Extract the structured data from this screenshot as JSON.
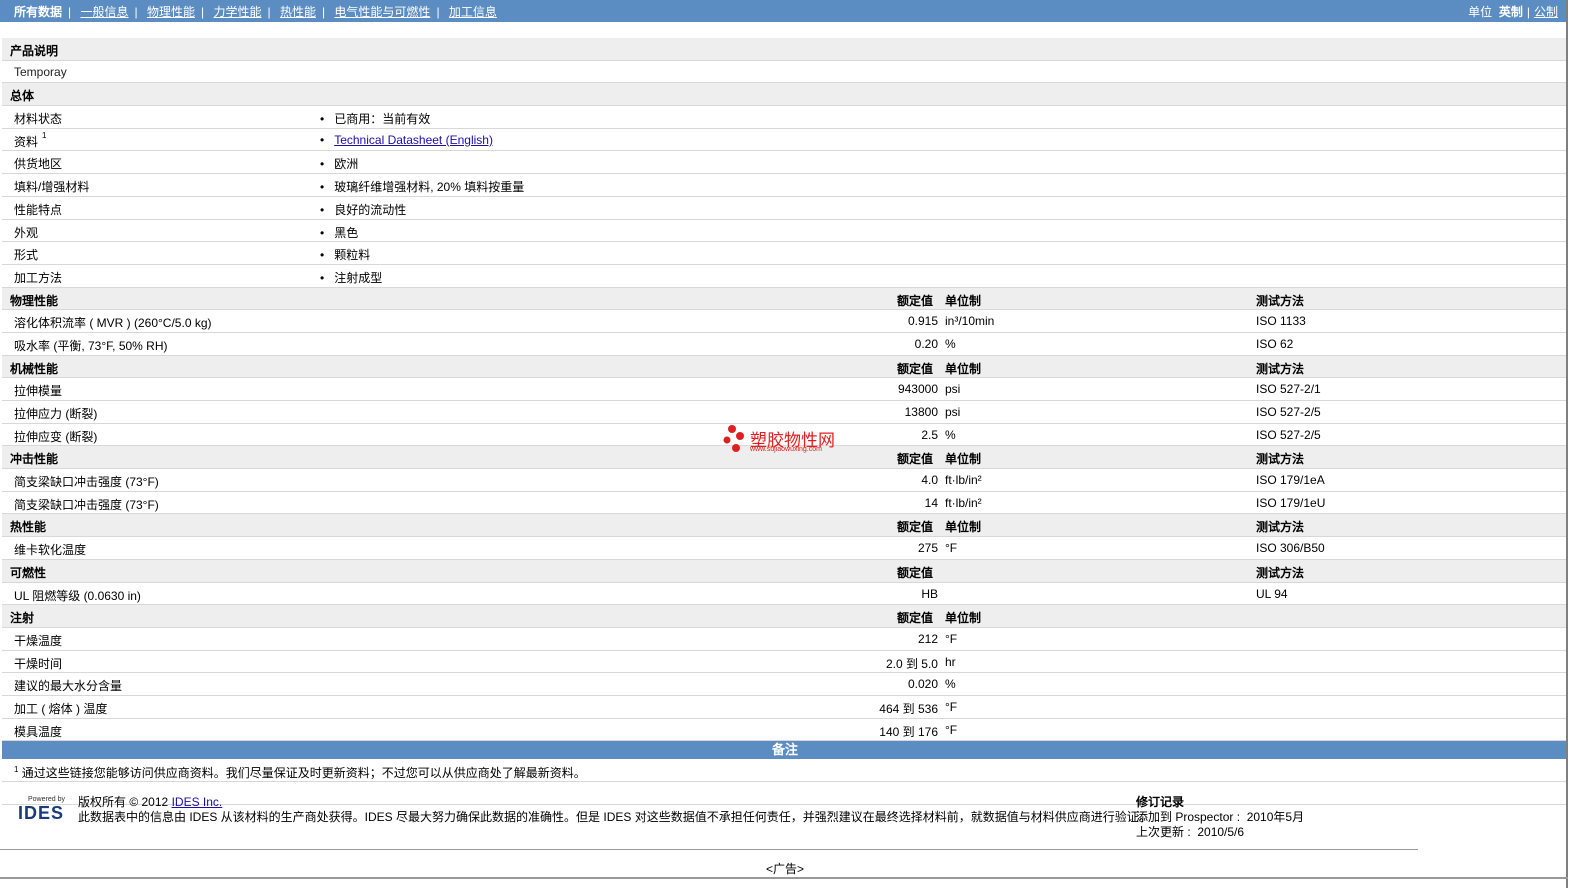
{
  "nav": {
    "items": [
      "所有数据",
      "一般信息",
      "物理性能",
      "力学性能",
      "热性能",
      "电气性能与可燃性",
      "加工信息"
    ],
    "units_label": "单位",
    "units": [
      "英制",
      "公制"
    ]
  },
  "product": {
    "section": "产品说明",
    "name": "Temporay"
  },
  "general": {
    "section": "总体",
    "rows": [
      {
        "name": "材料状态",
        "value": "已商用：当前有效"
      },
      {
        "name": "资料",
        "sup": "1",
        "value": "Technical Datasheet (English)"
      },
      {
        "name": "供货地区",
        "value": "欧洲"
      },
      {
        "name": "填料/增强材料",
        "value": "玻璃纤维增强材料, 20% 填料按重量"
      },
      {
        "name": "性能特点",
        "value": "良好的流动性"
      },
      {
        "name": "外观",
        "value": "黑色"
      },
      {
        "name": "形式",
        "value": "颗粒料"
      },
      {
        "name": "加工方法",
        "value": "注射成型"
      }
    ]
  },
  "headers": {
    "value": "额定值",
    "unit": "单位制",
    "method": "测试方法"
  },
  "sections": [
    {
      "title": "物理性能",
      "show_unit": true,
      "show_method": true,
      "rows": [
        {
          "name": "溶化体积流率 ( MVR )   (260°C/5.0 kg)",
          "value": "0.915",
          "unit": "in³/10min",
          "method": "ISO 1133"
        },
        {
          "name": "吸水率  (平衡, 73°F, 50% RH)",
          "value": "0.20",
          "unit": "%",
          "method": "ISO 62"
        }
      ]
    },
    {
      "title": "机械性能",
      "show_unit": true,
      "show_method": true,
      "rows": [
        {
          "name": "拉伸模量",
          "value": "943000",
          "unit": "psi",
          "method": "ISO 527-2/1"
        },
        {
          "name": "拉伸应力  (断裂)",
          "value": "13800",
          "unit": "psi",
          "method": "ISO 527-2/5"
        },
        {
          "name": "拉伸应变  (断裂)",
          "value": "2.5",
          "unit": "%",
          "method": "ISO 527-2/5"
        }
      ]
    },
    {
      "title": "冲击性能",
      "show_unit": true,
      "show_method": true,
      "rows": [
        {
          "name": "简支梁缺口冲击强度  (73°F)",
          "value": "4.0",
          "unit": "ft·lb/in²",
          "method": "ISO 179/1eA"
        },
        {
          "name": "简支梁缺口冲击强度  (73°F)",
          "value": "14",
          "unit": "ft·lb/in²",
          "method": "ISO 179/1eU"
        }
      ]
    },
    {
      "title": "热性能",
      "show_unit": true,
      "show_method": true,
      "rows": [
        {
          "name": "维卡软化温度",
          "value": "275",
          "unit": "°F",
          "method": "ISO 306/B50"
        }
      ]
    },
    {
      "title": "可燃性",
      "show_unit": false,
      "show_method": true,
      "rows": [
        {
          "name": "UL 阻燃等级  (0.0630 in)",
          "value": "HB",
          "unit": "",
          "method": "UL 94"
        }
      ]
    },
    {
      "title": "注射",
      "show_unit": true,
      "show_method": false,
      "rows": [
        {
          "name": "干燥温度",
          "value": "212",
          "unit": "°F",
          "method": ""
        },
        {
          "name": "干燥时间",
          "value": "2.0 到  5.0",
          "unit": "hr",
          "method": ""
        },
        {
          "name": "建议的最大水分含量",
          "value": "0.020",
          "unit": "%",
          "method": ""
        },
        {
          "name": "加工 ( 熔体 ) 温度",
          "value": "464 到  536",
          "unit": "°F",
          "method": ""
        },
        {
          "name": "模具温度",
          "value": "140 到  176",
          "unit": "°F",
          "method": ""
        }
      ]
    }
  ],
  "notes": {
    "title": "备注",
    "sup": "1",
    "text": "通过这些链接您能够访问供应商资料。我们尽量保证及时更新资料；不过您可以从供应商处了解最新资料。"
  },
  "footer": {
    "powered": "Powered by",
    "logo": "IDES",
    "copyright": "版权所有 © 2012",
    "company": "IDES Inc.",
    "disclaimer": "此数据表中的信息由  IDES 从该材料的生产商处获得。IDES 尽最大努力确保此数据的准确性。但是  IDES 对这些数据值不承担任何责任，并强烈建议在最终选择材料前，就数据值与材料供应商进行验证。",
    "rev_title": "修订记录",
    "added_label": "添加到  Prospector :",
    "added_value": "2010年5月",
    "updated_label": "上次更新 :",
    "updated_value": "2010/5/6",
    "ad": "<广告>"
  },
  "watermark": {
    "text": "塑胶物性网",
    "url": "www.sujiaowuxing.com"
  },
  "colors": {
    "header_bar": "#5b8cc2",
    "section_bg": "#eeeeee",
    "watermark": "#e02020"
  }
}
